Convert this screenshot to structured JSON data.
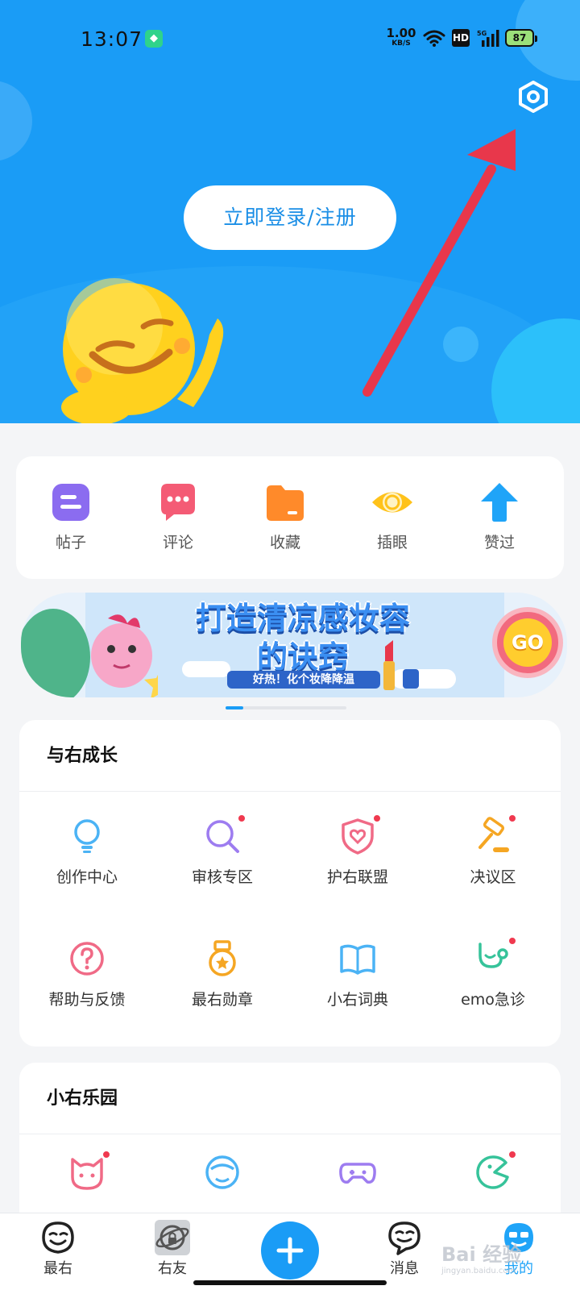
{
  "status_bar": {
    "time": "13:07",
    "net_speed_value": "1.00",
    "net_speed_unit": "KB/S",
    "hd": "HD",
    "signal": "5G",
    "battery": "87"
  },
  "hero": {
    "login_label": "立即登录/注册",
    "settings_icon": "hexagon-gear-icon",
    "bg_color": "#1a9cf6"
  },
  "shortcuts": [
    {
      "label": "帖子",
      "icon": "post-icon",
      "color": "#8b6cf0"
    },
    {
      "label": "评论",
      "icon": "comment-icon",
      "color": "#f45b75"
    },
    {
      "label": "收藏",
      "icon": "folder-icon",
      "color": "#ff8a2a"
    },
    {
      "label": "插眼",
      "icon": "eye-icon",
      "color": "#ffc21a"
    },
    {
      "label": "赞过",
      "icon": "upvote-arrow-icon",
      "color": "#1fa4f8"
    }
  ],
  "banner": {
    "title_line1": "打造清凉感妆容",
    "title_line2": "的诀窍",
    "subtitle": "好热！化个妆降降温",
    "go_label": "GO"
  },
  "growth": {
    "title": "与右成长",
    "items": [
      {
        "label": "创作中心",
        "icon": "lightbulb-icon",
        "dot": false
      },
      {
        "label": "审核专区",
        "icon": "magnifier-icon",
        "dot": true
      },
      {
        "label": "护右联盟",
        "icon": "shield-heart-icon",
        "dot": true
      },
      {
        "label": "决议区",
        "icon": "gavel-icon",
        "dot": true
      },
      {
        "label": "帮助与反馈",
        "icon": "question-icon",
        "dot": false
      },
      {
        "label": "最右勋章",
        "icon": "medal-icon",
        "dot": false
      },
      {
        "label": "小右词典",
        "icon": "book-icon",
        "dot": false
      },
      {
        "label": "emo急诊",
        "icon": "stethoscope-icon",
        "dot": true
      }
    ]
  },
  "park": {
    "title": "小右乐园",
    "items": [
      {
        "icon": "cat-face-icon",
        "dot": true
      },
      {
        "icon": "astronaut-face-icon",
        "dot": false
      },
      {
        "icon": "gamepad-icon",
        "dot": false
      },
      {
        "icon": "pacman-icon",
        "dot": true
      }
    ]
  },
  "tabbar": {
    "tabs": [
      {
        "label": "最右",
        "icon": "smile-face-icon"
      },
      {
        "label": "右友",
        "icon": "planet-lock-icon"
      },
      {
        "label": "",
        "icon": "plus-icon"
      },
      {
        "label": "消息",
        "icon": "message-face-icon"
      },
      {
        "label": "我的",
        "icon": "profile-face-icon"
      }
    ]
  },
  "watermark": {
    "text": "Bai 经验",
    "sub": "jingyan.baidu.com"
  }
}
